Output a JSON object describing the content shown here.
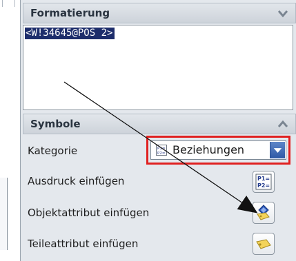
{
  "formatierung": {
    "title": "Formatierung",
    "content": "<W!34645@POS 2>"
  },
  "symbole": {
    "title": "Symbole",
    "kategorie_label": "Kategorie",
    "kategorie_value": "Beziehungen",
    "rows": [
      {
        "label": "Ausdruck einfügen",
        "icon": "p1-p2-icon"
      },
      {
        "label": "Objektattribut einfügen",
        "icon": "object-attribute-icon"
      },
      {
        "label": "Teileattribut einfügen",
        "icon": "part-attribute-icon"
      }
    ]
  },
  "colors": {
    "highlight": "#e02020",
    "selection": "#1d2d6b",
    "panel": "#e4e8ed"
  }
}
